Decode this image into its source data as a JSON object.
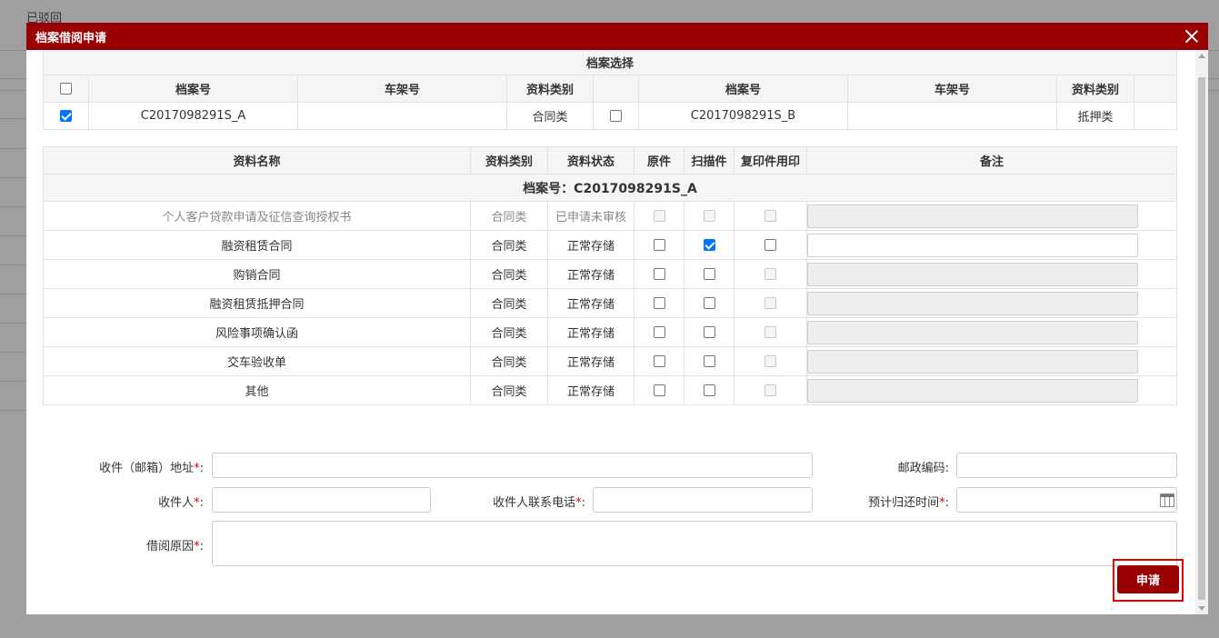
{
  "background": {
    "status_text": "已驳回"
  },
  "dialog": {
    "title": "档案借阅申请",
    "selection": {
      "caption": "档案选择",
      "headers": [
        "档案号",
        "车架号",
        "资料类别"
      ],
      "left": {
        "checked": true,
        "archive_no": "C2017098291S_A",
        "frame_no": "",
        "category": "合同类"
      },
      "right": {
        "checked": false,
        "archive_no": "C2017098291S_B",
        "frame_no": "",
        "category": "抵押类"
      }
    },
    "documents": {
      "headers": {
        "name": "资料名称",
        "category": "资料类别",
        "status": "资料状态",
        "original": "原件",
        "scan": "扫描件",
        "copy": "复印件用印",
        "remark": "备注"
      },
      "group_label": "档案号：C2017098291S_A",
      "rows": [
        {
          "name": "个人客户贷款申请及征信查询授权书",
          "category": "合同类",
          "status": "已申请未审核",
          "original": false,
          "scan": false,
          "copy": false,
          "disabled": true,
          "remark_enabled": false
        },
        {
          "name": "融资租赁合同",
          "category": "合同类",
          "status": "正常存储",
          "original": false,
          "scan": true,
          "copy": false,
          "disabled": false,
          "remark_enabled": true
        },
        {
          "name": "购销合同",
          "category": "合同类",
          "status": "正常存储",
          "original": false,
          "scan": false,
          "copy": false,
          "disabled": false,
          "remark_enabled": false
        },
        {
          "name": "融资租赁抵押合同",
          "category": "合同类",
          "status": "正常存储",
          "original": false,
          "scan": false,
          "copy": false,
          "disabled": false,
          "remark_enabled": false
        },
        {
          "name": "风险事项确认函",
          "category": "合同类",
          "status": "正常存储",
          "original": false,
          "scan": false,
          "copy": false,
          "disabled": false,
          "remark_enabled": false
        },
        {
          "name": "交车验收单",
          "category": "合同类",
          "status": "正常存储",
          "original": false,
          "scan": false,
          "copy": false,
          "disabled": false,
          "remark_enabled": false
        },
        {
          "name": "其他",
          "category": "合同类",
          "status": "正常存储",
          "original": false,
          "scan": false,
          "copy": false,
          "disabled": false,
          "remark_enabled": false
        }
      ]
    },
    "form": {
      "address_label": "收件（邮箱）地址",
      "postal_label": "邮政编码",
      "recipient_label": "收件人",
      "phone_label": "收件人联系电话",
      "return_time_label": "预计归还时间",
      "reason_label": "借阅原因",
      "required_mark": "*",
      "label_suffix": ":"
    },
    "submit_label": "申请"
  }
}
